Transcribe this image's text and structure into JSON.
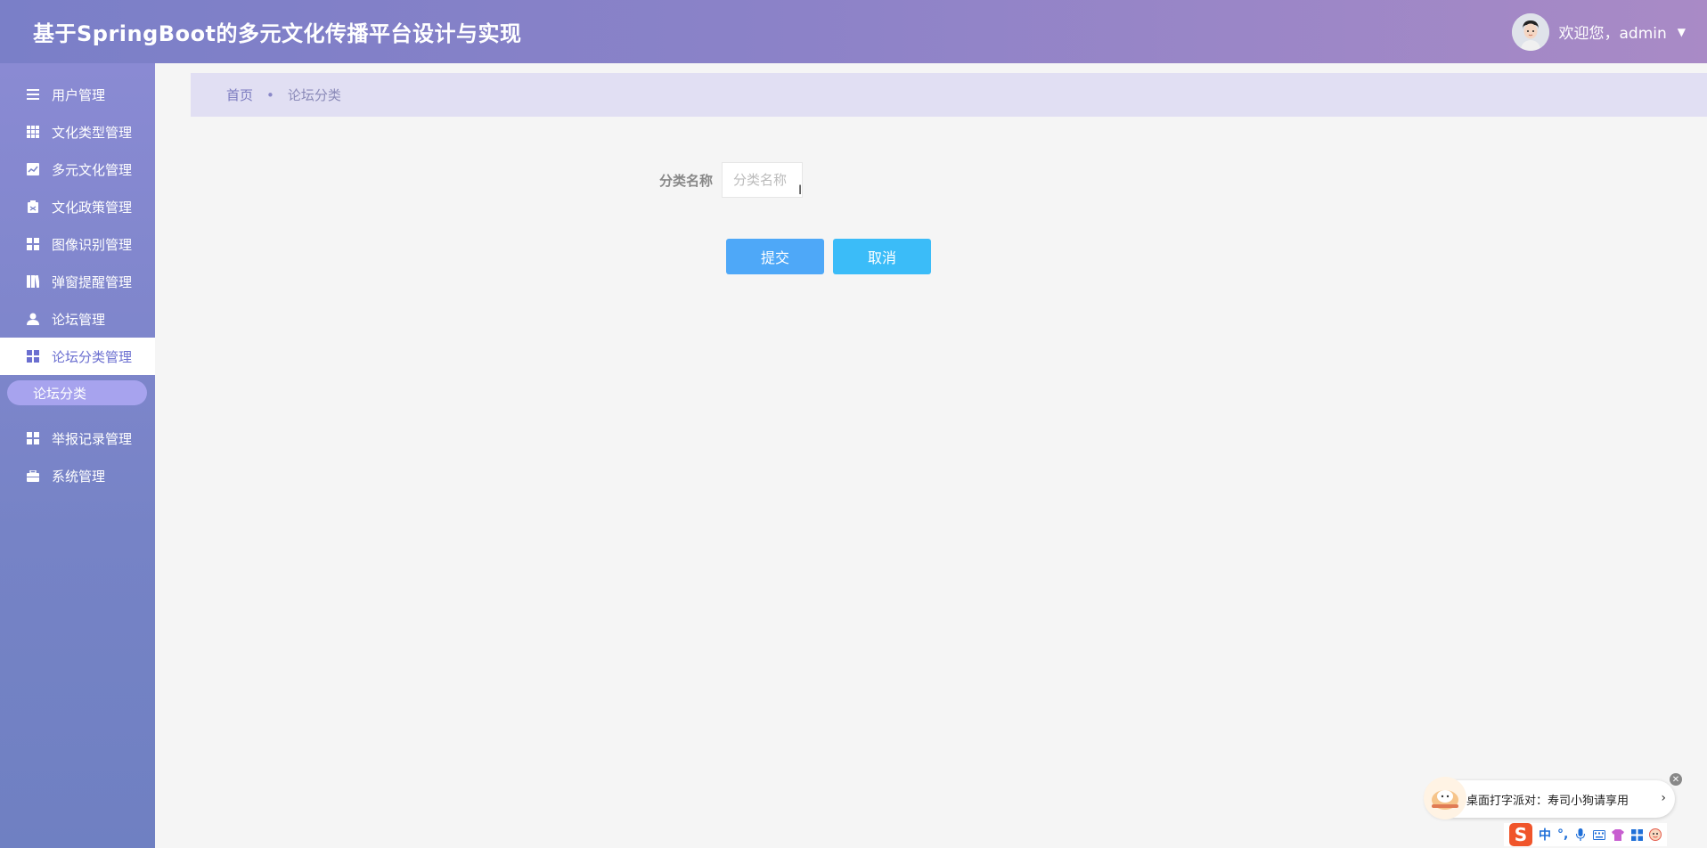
{
  "header": {
    "title": "基于SpringBoot的多元文化传播平台设计与实现",
    "welcome": "欢迎您，admin"
  },
  "sidebar": {
    "items": [
      {
        "label": "用户管理",
        "icon": "list-icon"
      },
      {
        "label": "文化类型管理",
        "icon": "grid-icon"
      },
      {
        "label": "多元文化管理",
        "icon": "chart-icon"
      },
      {
        "label": "文化政策管理",
        "icon": "clipboard-icon"
      },
      {
        "label": "图像识别管理",
        "icon": "dashboard-icon"
      },
      {
        "label": "弹窗提醒管理",
        "icon": "book-icon"
      },
      {
        "label": "论坛管理",
        "icon": "user-icon"
      },
      {
        "label": "论坛分类管理",
        "icon": "dashboard-icon",
        "active": true
      },
      {
        "label": "举报记录管理",
        "icon": "dashboard-icon"
      },
      {
        "label": "系统管理",
        "icon": "briefcase-icon"
      }
    ],
    "submenu": {
      "label": "论坛分类"
    }
  },
  "breadcrumb": {
    "home": "首页",
    "separator": "•",
    "current": "论坛分类"
  },
  "form": {
    "category_label": "分类名称",
    "category_placeholder": "分类名称",
    "category_value": "",
    "submit_label": "提交",
    "cancel_label": "取消"
  },
  "ime": {
    "promo_text": "桌面打字派对：寿司小狗请享用",
    "logo": "S",
    "mode": "中",
    "punct": "°,"
  },
  "colors": {
    "accent": "#7a7fc8",
    "active_text": "#6b6fd0",
    "submit": "#4ea8f8",
    "cancel": "#3bbcf8"
  }
}
